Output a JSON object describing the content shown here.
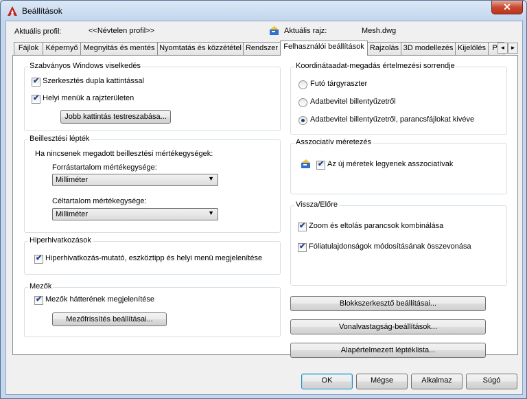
{
  "window": {
    "title": "Beállítások",
    "close": "✕"
  },
  "header": {
    "profile_label": "Aktuális profil:",
    "profile_value": "<<Névtelen profil>>",
    "drawing_label": "Aktuális rajz:",
    "drawing_value": "Mesh.dwg"
  },
  "tabs": [
    "Fájlok",
    "Képernyő",
    "Megnyitás és mentés",
    "Nyomtatás és közzététel",
    "Rendszer",
    "Felhasználói beállítások",
    "Rajzolás",
    "3D modellezés",
    "Kijelölés",
    "Pr"
  ],
  "active_tab": "Felhasználói beállítások",
  "scroll": {
    "left": "◄",
    "right": "►"
  },
  "windows_group": {
    "title": "Szabványos Windows viselkedés",
    "double_click": "Szerkesztés dupla kattintással",
    "shortcut_menus": "Helyi menük a rajzterületen",
    "right_click_btn": "Jobb kattintás testreszabása..."
  },
  "insert_group": {
    "title": "Beillesztési lépték",
    "description": "Ha nincsenek megadott beillesztési mértékegységek:",
    "source_label": "Forrástartalom mértékegysége:",
    "source_value": "Milliméter",
    "target_label": "Céltartalom mértékegysége:",
    "target_value": "Milliméter"
  },
  "hyperlink_group": {
    "title": "Hiperhivatkozások",
    "option": "Hiperhivatkozás-mutató, eszköztipp és helyi menü megjelenítése"
  },
  "fields_group": {
    "title": "Mezők",
    "option": "Mezők hátterének megjelenítése",
    "update_btn": "Mezőfrissítés beállításai..."
  },
  "coord_group": {
    "title": "Koordinátaadat-megadás értelmezési sorrendje",
    "opt1": "Futó tárgyraszter",
    "opt2": "Adatbevitel billentyűzetről",
    "opt3": "Adatbevitel billentyűzetről, parancsfájlokat kivéve",
    "selected": 3
  },
  "assoc_group": {
    "title": "Asszociatív méretezés",
    "option": "Az új méretek legyenek asszociatívak"
  },
  "undo_group": {
    "title": "Vissza/Előre",
    "zoom": "Zoom és eltolás parancsok kombinálása",
    "layer": "Fóliatulajdonságok módosításának összevonása"
  },
  "right_buttons": {
    "block_editor": "Blokkszerkesztő beállításai...",
    "lineweight": "Vonalvastagság-beállítások...",
    "scale_list": "Alapértelmezett léptéklista..."
  },
  "footer": {
    "ok": "OK",
    "cancel": "Mégse",
    "apply": "Alkalmaz",
    "help": "Súgó"
  },
  "check_mark": "✔",
  "select_arrow": "▼"
}
